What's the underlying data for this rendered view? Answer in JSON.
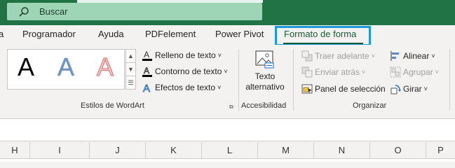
{
  "search": {
    "label": "Buscar"
  },
  "tabs": [
    {
      "label": "a"
    },
    {
      "label": "Programador"
    },
    {
      "label": "Ayuda"
    },
    {
      "label": "PDFelement"
    },
    {
      "label": "Power Pivot"
    },
    {
      "label": "Formato de forma"
    }
  ],
  "wordart": {
    "samples": [
      "A",
      "A",
      "A"
    ],
    "group_label": "Estilos de WordArt",
    "text_fill": "Relleno de texto",
    "text_outline": "Contorno de texto",
    "text_effects": "Efectos de texto"
  },
  "accessibility": {
    "alt_text_line1": "Texto",
    "alt_text_line2": "alternativo",
    "group_label": "Accesibilidad"
  },
  "arrange": {
    "bring_forward": "Traer adelante",
    "send_backward": "Enviar atrás",
    "selection_pane": "Panel de selección",
    "align": "Alinear",
    "group": "Agrupar",
    "rotate": "Girar",
    "group_label": "Organizar"
  },
  "columns": [
    "H",
    "I",
    "J",
    "K",
    "L",
    "M",
    "N",
    "O",
    "P"
  ],
  "colors": {
    "excel_green": "#217346",
    "search_bg": "#9fd5b7",
    "highlight_border": "#1b9ad7"
  }
}
